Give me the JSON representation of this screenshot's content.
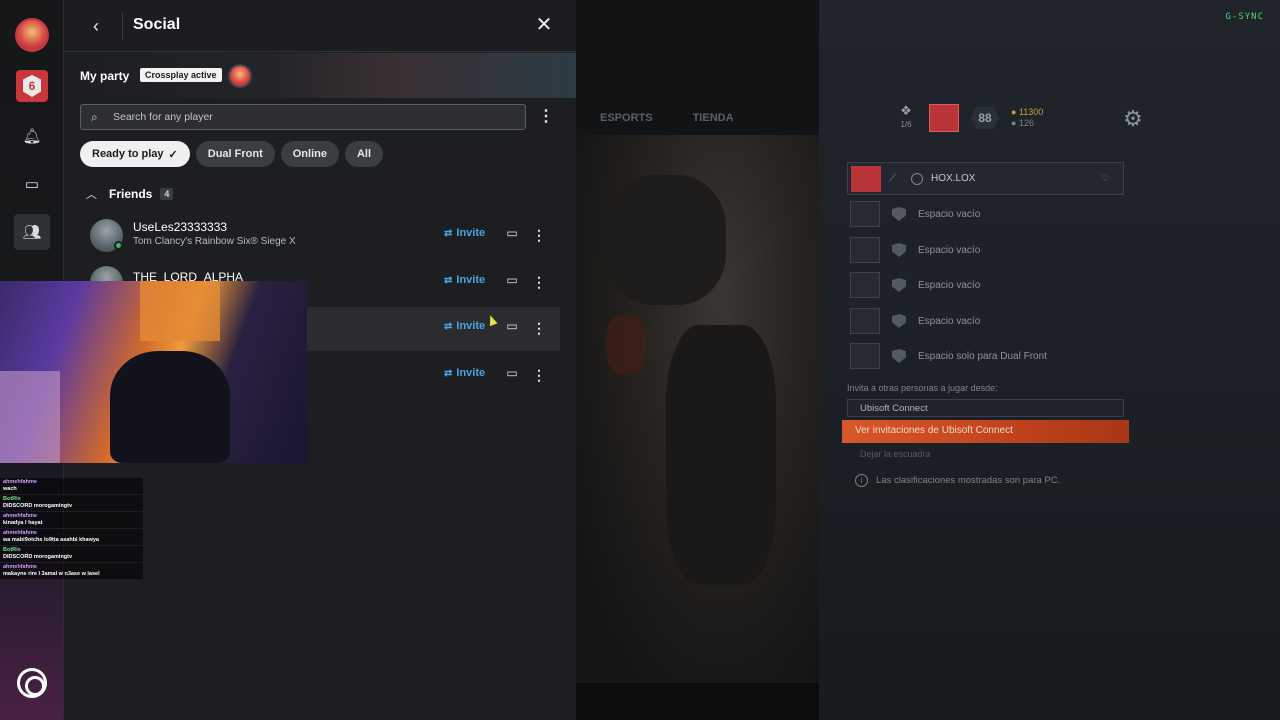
{
  "overlay": {
    "gsync": "G-SYNC"
  },
  "background_tabs": [
    "ESPORTS",
    "TIENDA"
  ],
  "party_header": {
    "count": "1/6",
    "level": "88",
    "credits": "11300",
    "renown": "126"
  },
  "party_slots": {
    "main_name": "HOX.LOX",
    "empty": [
      "Espacio vacío",
      "Espacio vacío",
      "Espacio vacío",
      "Espacio vacío"
    ],
    "dual_front": "Espacio solo para Dual Front"
  },
  "invite_section": {
    "label": "Invita a otras personas a jugar desde:",
    "source": "Ubisoft Connect",
    "view_button": "Ver invitaciones de Ubisoft Connect",
    "leave": "Dejar la escuadra",
    "info": "Las clasificaciones mostradas son para PC."
  },
  "social": {
    "title": "Social",
    "my_party": "My party",
    "crossplay": "Crossplay active",
    "search_placeholder": "Search for any player",
    "filters": [
      "Ready to play",
      "Dual Front",
      "Online",
      "All"
    ],
    "friends_label": "Friends",
    "friends_count": "4",
    "friends": [
      {
        "name": "UseLes23333333",
        "game": "Tom Clancy's Rainbow Six® Siege X",
        "invite": "Invite",
        "online": true
      },
      {
        "name": "THE_LORD_ALPHA",
        "game": "",
        "invite": "Invite",
        "online": false
      },
      {
        "name": "",
        "game": "",
        "invite": "Invite",
        "online": false
      },
      {
        "name": "",
        "game": "",
        "invite": "Invite",
        "online": false
      }
    ]
  },
  "chat_overlay": [
    {
      "user": "ahmehfahme",
      "text": "wach"
    },
    {
      "user": "BotRix",
      "text": "DIDSCORD morogamingtv"
    },
    {
      "user": "ahmehfahme",
      "text": "kinadya l hayat"
    },
    {
      "user": "ahmehfahme",
      "text": "wa mabi9otche lo9tta asahbi khawya"
    },
    {
      "user": "BotRix",
      "text": "DIDSCORD morogamingtv"
    },
    {
      "user": "ahmehfahme",
      "text": "makayne rire l 3amal w n3ase w lasel"
    }
  ]
}
